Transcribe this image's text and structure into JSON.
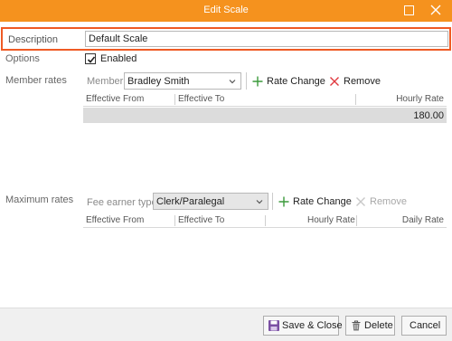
{
  "window": {
    "title": "Edit Scale"
  },
  "description": {
    "label": "Description",
    "value": "Default Scale"
  },
  "options": {
    "label": "Options",
    "enabled_label": "Enabled",
    "enabled": true
  },
  "member_rates": {
    "label": "Member rates",
    "filter_label": "Member",
    "member_value": "Bradley Smith",
    "rate_change_label": "Rate Change",
    "remove_label": "Remove",
    "columns": [
      "Effective From",
      "Effective To",
      "Hourly Rate"
    ],
    "rows": [
      {
        "effective_from": "",
        "effective_to": "",
        "hourly_rate": "180.00"
      }
    ]
  },
  "maximum_rates": {
    "label": "Maximum rates",
    "filter_label": "Fee earner type",
    "fee_earner_value": "Clerk/Paralegal",
    "rate_change_label": "Rate Change",
    "remove_label": "Remove",
    "columns": [
      "Effective From",
      "Effective To",
      "Hourly Rate",
      "Daily Rate"
    ]
  },
  "footer": {
    "save_close_label": "Save & Close",
    "delete_label": "Delete",
    "cancel_label": "Cancel"
  },
  "colors": {
    "titlebar": "#f5921e",
    "highlight": "#ef5a24",
    "add_icon": "#3c9a3c",
    "remove_icon": "#e0393e"
  }
}
